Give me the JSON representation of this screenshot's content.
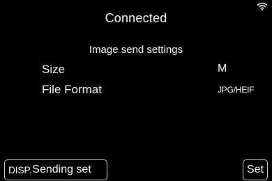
{
  "status": {
    "wifi_icon": "wifi-icon",
    "wifi_color": "#ffffff"
  },
  "header": {
    "title": "Connected",
    "subtitle": "Image send settings"
  },
  "settings": [
    {
      "label": "Size",
      "value": "M"
    },
    {
      "label": "File Format",
      "value": "JPG/HEIF"
    }
  ],
  "footer": {
    "disp_key": "DISP.",
    "sending_set_label": "Sending set",
    "set_label": "Set"
  },
  "colors": {
    "background": "#000000",
    "text": "#ffffff",
    "button_border": "#cfcfcf"
  }
}
